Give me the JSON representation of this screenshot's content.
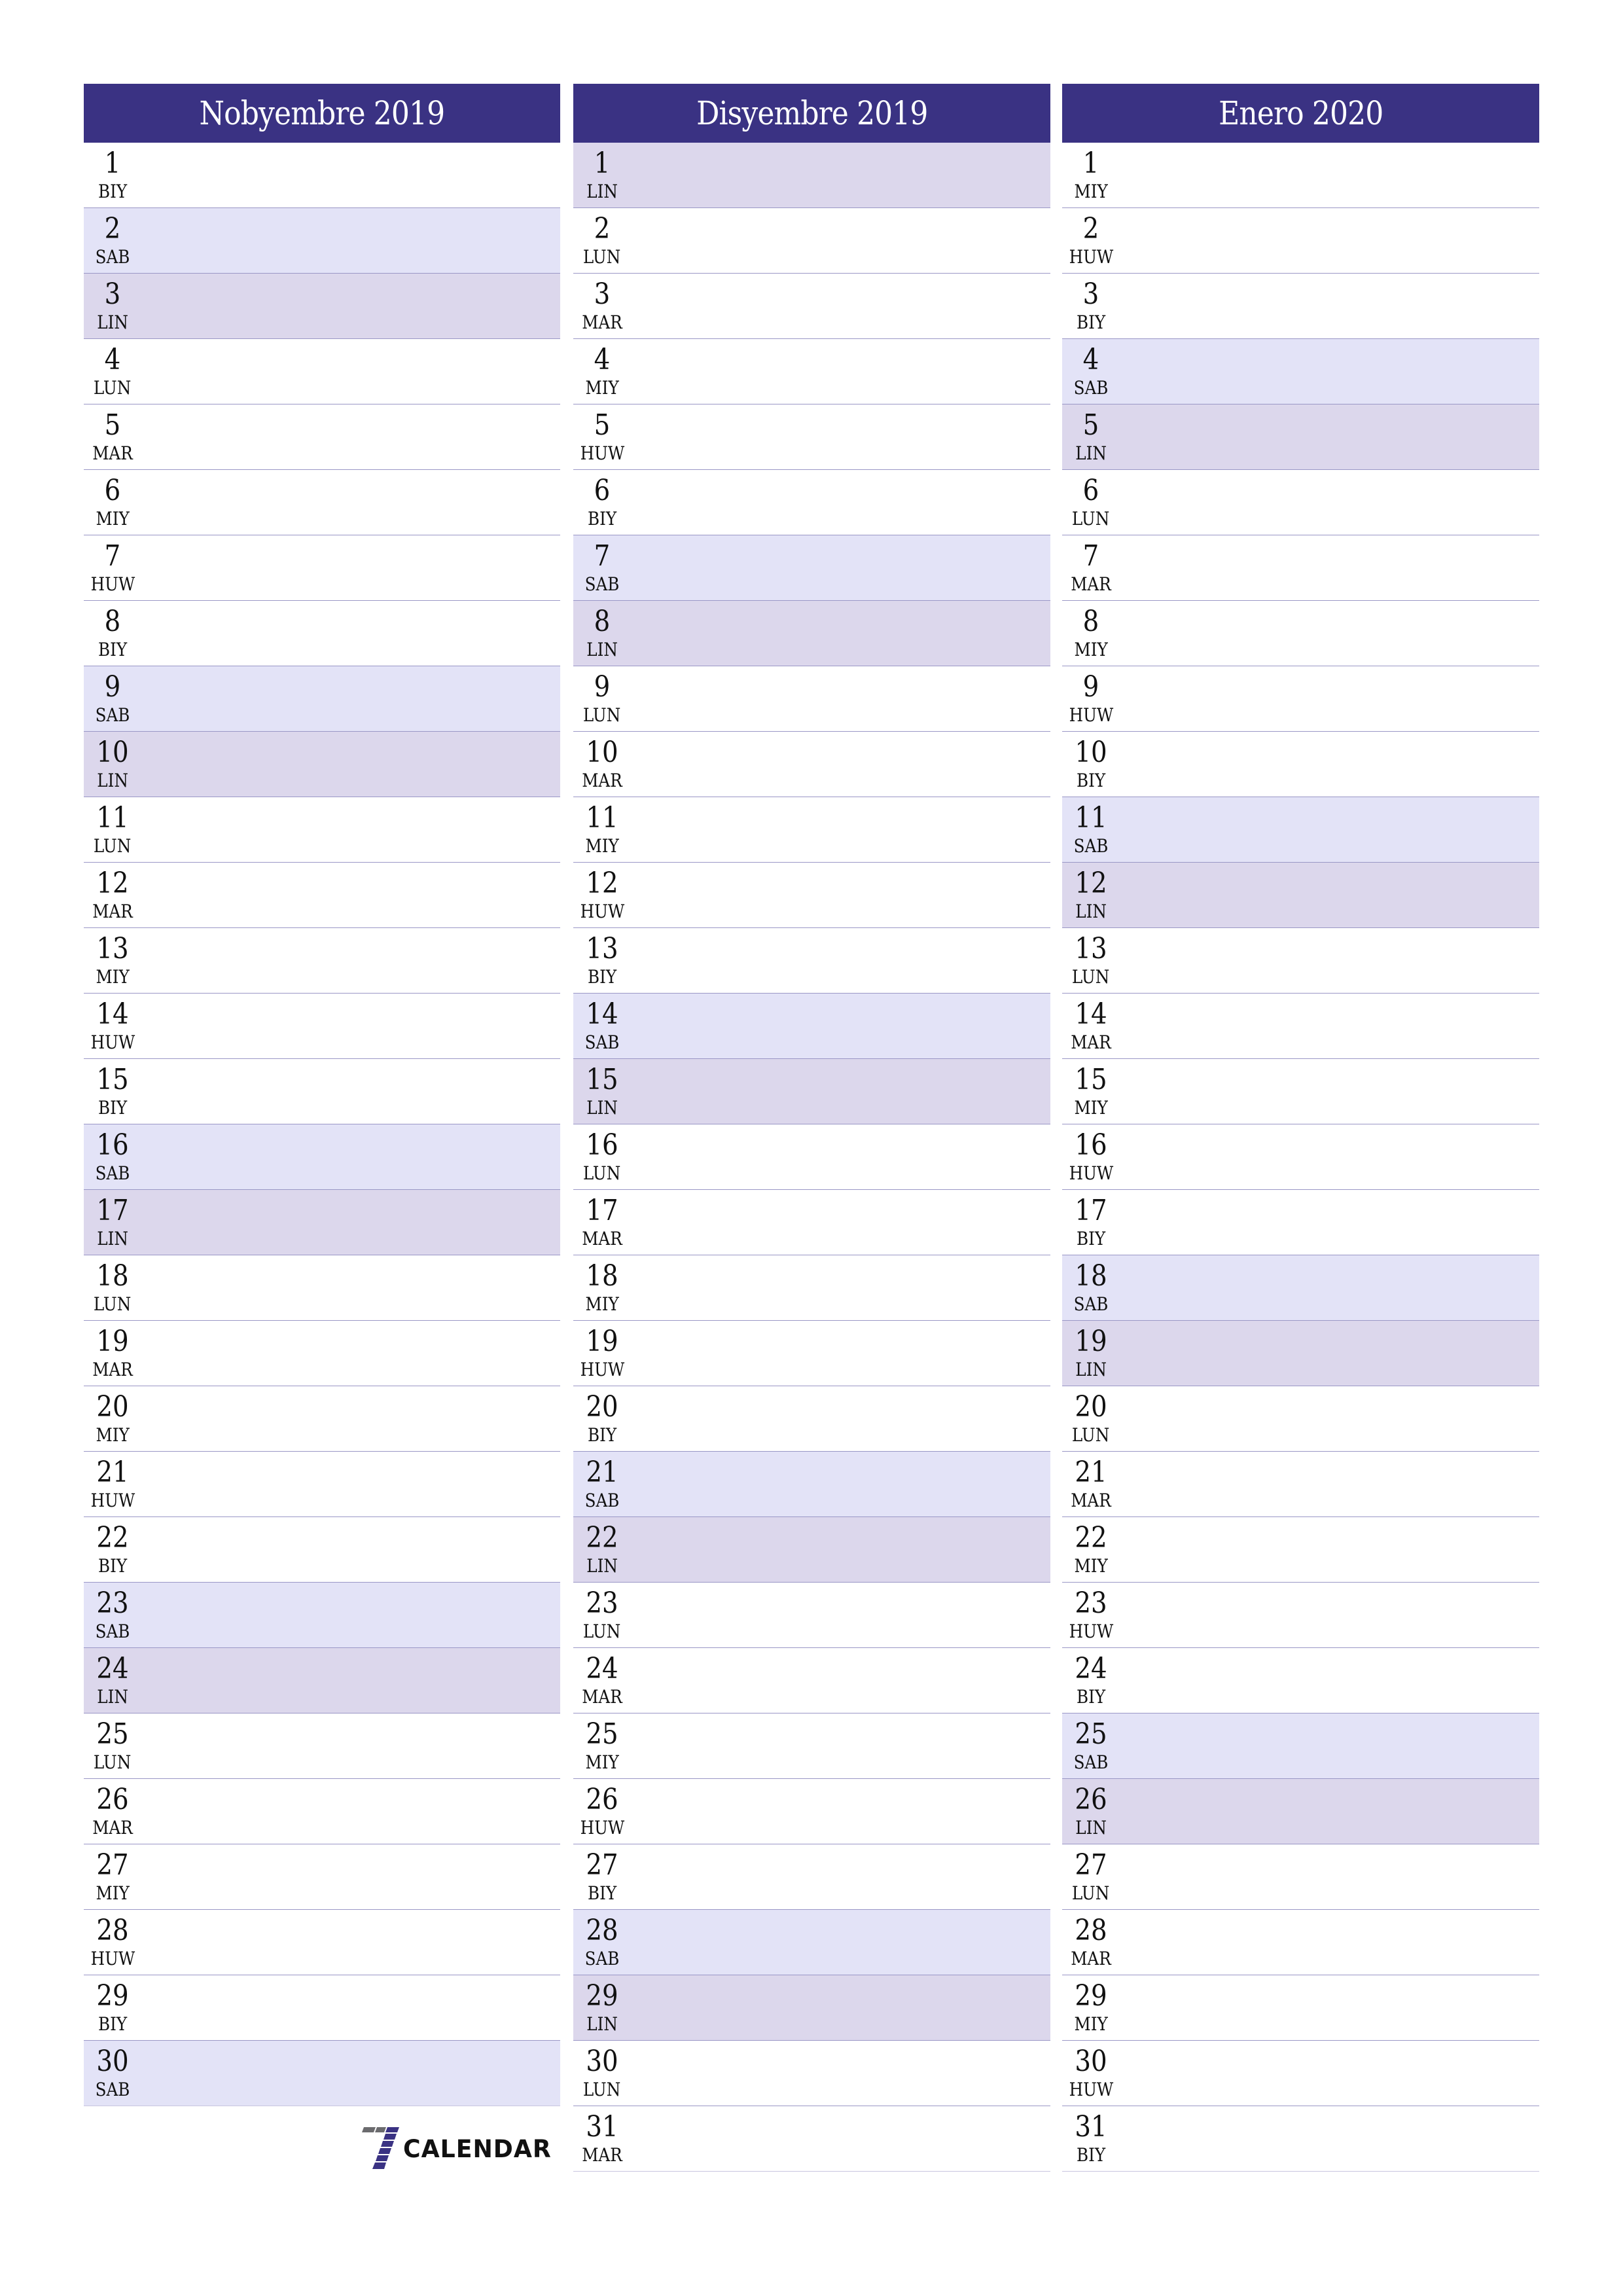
{
  "colors": {
    "header": "#3a3283",
    "saturday": "#e3e3f7",
    "sunday": "#dcd7ec",
    "separator": "#9a97c6"
  },
  "months": [
    {
      "title": "Nobyembre 2019",
      "days": [
        {
          "num": "1",
          "name": "BIY"
        },
        {
          "num": "2",
          "name": "SAB"
        },
        {
          "num": "3",
          "name": "LIN"
        },
        {
          "num": "4",
          "name": "LUN"
        },
        {
          "num": "5",
          "name": "MAR"
        },
        {
          "num": "6",
          "name": "MIY"
        },
        {
          "num": "7",
          "name": "HUW"
        },
        {
          "num": "8",
          "name": "BIY"
        },
        {
          "num": "9",
          "name": "SAB"
        },
        {
          "num": "10",
          "name": "LIN"
        },
        {
          "num": "11",
          "name": "LUN"
        },
        {
          "num": "12",
          "name": "MAR"
        },
        {
          "num": "13",
          "name": "MIY"
        },
        {
          "num": "14",
          "name": "HUW"
        },
        {
          "num": "15",
          "name": "BIY"
        },
        {
          "num": "16",
          "name": "SAB"
        },
        {
          "num": "17",
          "name": "LIN"
        },
        {
          "num": "18",
          "name": "LUN"
        },
        {
          "num": "19",
          "name": "MAR"
        },
        {
          "num": "20",
          "name": "MIY"
        },
        {
          "num": "21",
          "name": "HUW"
        },
        {
          "num": "22",
          "name": "BIY"
        },
        {
          "num": "23",
          "name": "SAB"
        },
        {
          "num": "24",
          "name": "LIN"
        },
        {
          "num": "25",
          "name": "LUN"
        },
        {
          "num": "26",
          "name": "MAR"
        },
        {
          "num": "27",
          "name": "MIY"
        },
        {
          "num": "28",
          "name": "HUW"
        },
        {
          "num": "29",
          "name": "BIY"
        },
        {
          "num": "30",
          "name": "SAB"
        }
      ]
    },
    {
      "title": "Disyembre 2019",
      "days": [
        {
          "num": "1",
          "name": "LIN"
        },
        {
          "num": "2",
          "name": "LUN"
        },
        {
          "num": "3",
          "name": "MAR"
        },
        {
          "num": "4",
          "name": "MIY"
        },
        {
          "num": "5",
          "name": "HUW"
        },
        {
          "num": "6",
          "name": "BIY"
        },
        {
          "num": "7",
          "name": "SAB"
        },
        {
          "num": "8",
          "name": "LIN"
        },
        {
          "num": "9",
          "name": "LUN"
        },
        {
          "num": "10",
          "name": "MAR"
        },
        {
          "num": "11",
          "name": "MIY"
        },
        {
          "num": "12",
          "name": "HUW"
        },
        {
          "num": "13",
          "name": "BIY"
        },
        {
          "num": "14",
          "name": "SAB"
        },
        {
          "num": "15",
          "name": "LIN"
        },
        {
          "num": "16",
          "name": "LUN"
        },
        {
          "num": "17",
          "name": "MAR"
        },
        {
          "num": "18",
          "name": "MIY"
        },
        {
          "num": "19",
          "name": "HUW"
        },
        {
          "num": "20",
          "name": "BIY"
        },
        {
          "num": "21",
          "name": "SAB"
        },
        {
          "num": "22",
          "name": "LIN"
        },
        {
          "num": "23",
          "name": "LUN"
        },
        {
          "num": "24",
          "name": "MAR"
        },
        {
          "num": "25",
          "name": "MIY"
        },
        {
          "num": "26",
          "name": "HUW"
        },
        {
          "num": "27",
          "name": "BIY"
        },
        {
          "num": "28",
          "name": "SAB"
        },
        {
          "num": "29",
          "name": "LIN"
        },
        {
          "num": "30",
          "name": "LUN"
        },
        {
          "num": "31",
          "name": "MAR"
        }
      ]
    },
    {
      "title": "Enero 2020",
      "days": [
        {
          "num": "1",
          "name": "MIY"
        },
        {
          "num": "2",
          "name": "HUW"
        },
        {
          "num": "3",
          "name": "BIY"
        },
        {
          "num": "4",
          "name": "SAB"
        },
        {
          "num": "5",
          "name": "LIN"
        },
        {
          "num": "6",
          "name": "LUN"
        },
        {
          "num": "7",
          "name": "MAR"
        },
        {
          "num": "8",
          "name": "MIY"
        },
        {
          "num": "9",
          "name": "HUW"
        },
        {
          "num": "10",
          "name": "BIY"
        },
        {
          "num": "11",
          "name": "SAB"
        },
        {
          "num": "12",
          "name": "LIN"
        },
        {
          "num": "13",
          "name": "LUN"
        },
        {
          "num": "14",
          "name": "MAR"
        },
        {
          "num": "15",
          "name": "MIY"
        },
        {
          "num": "16",
          "name": "HUW"
        },
        {
          "num": "17",
          "name": "BIY"
        },
        {
          "num": "18",
          "name": "SAB"
        },
        {
          "num": "19",
          "name": "LIN"
        },
        {
          "num": "20",
          "name": "LUN"
        },
        {
          "num": "21",
          "name": "MAR"
        },
        {
          "num": "22",
          "name": "MIY"
        },
        {
          "num": "23",
          "name": "HUW"
        },
        {
          "num": "24",
          "name": "BIY"
        },
        {
          "num": "25",
          "name": "SAB"
        },
        {
          "num": "26",
          "name": "LIN"
        },
        {
          "num": "27",
          "name": "LUN"
        },
        {
          "num": "28",
          "name": "MAR"
        },
        {
          "num": "29",
          "name": "MIY"
        },
        {
          "num": "30",
          "name": "HUW"
        },
        {
          "num": "31",
          "name": "BIY"
        }
      ]
    }
  ],
  "logo": {
    "icon": "seven-calendar-logo-icon",
    "text": "CALENDAR"
  }
}
